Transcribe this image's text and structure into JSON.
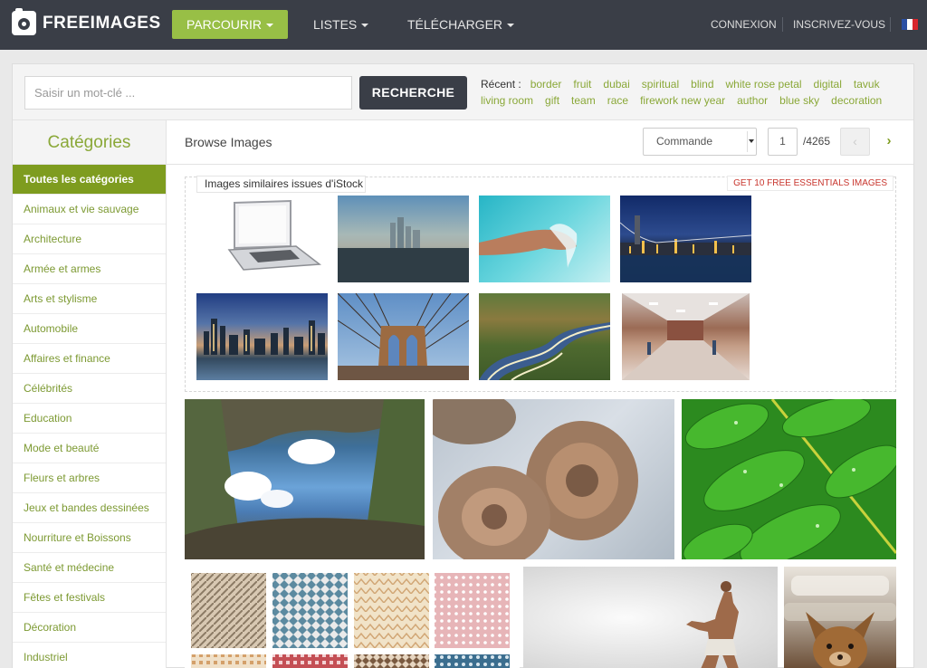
{
  "brand": {
    "name": "FREEIMAGES"
  },
  "nav": {
    "browse": "PARCOURIR",
    "lists": "LISTES",
    "download": "TÉLÉCHARGER",
    "login": "CONNEXION",
    "register": "INSCRIVEZ-VOUS"
  },
  "colors": {
    "accent": "#98bf46",
    "dark": "#3a3e47",
    "link": "#8aa838"
  },
  "search": {
    "placeholder": "Saisir un mot-clé ...",
    "button": "RECHERCHE",
    "recent_label": "Récent :",
    "recent_tags": [
      "border",
      "fruit",
      "dubai",
      "spiritual",
      "blind",
      "white rose petal",
      "digital",
      "tavuk",
      "living room",
      "gift",
      "team",
      "race",
      "firework new year",
      "author",
      "blue sky",
      "decoration"
    ]
  },
  "sidebar": {
    "title": "Catégories",
    "items": [
      "Toutes les catégories",
      "Animaux et vie sauvage",
      "Architecture",
      "Armée et armes",
      "Arts et stylisme",
      "Automobile",
      "Affaires et finance",
      "Célébrités",
      "Education",
      "Mode et beauté",
      "Fleurs et arbres",
      "Jeux et bandes dessinées",
      "Nourriture et Boissons",
      "Santé et médecine",
      "Fêtes et festivals",
      "Décoration",
      "Industriel"
    ]
  },
  "main": {
    "title": "Browse Images",
    "sort_label": "Commande",
    "page_current": "1",
    "page_total": "/4265"
  },
  "istock": {
    "title": "Images similaires issues d'iStock",
    "cta": "GET 10 FREE ESSENTIALS IMAGES"
  }
}
